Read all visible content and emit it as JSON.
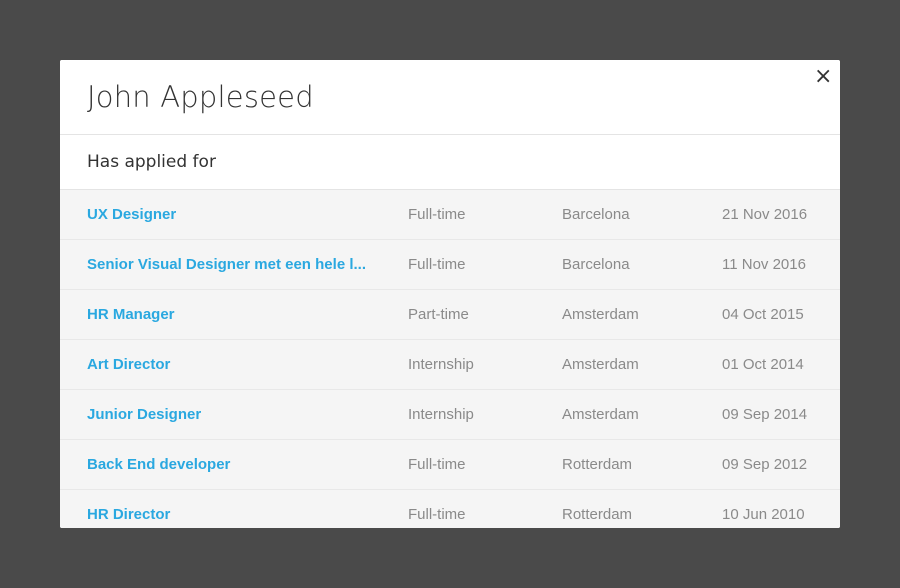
{
  "modal": {
    "title": "John Appleseed",
    "close_label": "×"
  },
  "section": {
    "title": "Has applied for"
  },
  "jobs": [
    {
      "title": "UX Designer",
      "type": "Full-time",
      "location": "Barcelona",
      "date": "21 Nov 2016"
    },
    {
      "title": "Senior Visual Designer met een hele l...",
      "type": "Full-time",
      "location": "Barcelona",
      "date": "11 Nov 2016"
    },
    {
      "title": "HR Manager",
      "type": "Part-time",
      "location": "Amsterdam",
      "date": "04 Oct 2015"
    },
    {
      "title": "Art Director",
      "type": "Internship",
      "location": "Amsterdam",
      "date": "01 Oct 2014"
    },
    {
      "title": "Junior Designer",
      "type": "Internship",
      "location": "Amsterdam",
      "date": "09 Sep 2014"
    },
    {
      "title": "Back End developer",
      "type": "Full-time",
      "location": "Rotterdam",
      "date": "09 Sep 2012"
    },
    {
      "title": "HR Director",
      "type": "Full-time",
      "location": "Rotterdam",
      "date": "10 Jun 2010"
    }
  ],
  "colors": {
    "backdrop": "#4a4a4a",
    "link": "#2aa8e0",
    "muted_text": "#8a8a8a"
  }
}
